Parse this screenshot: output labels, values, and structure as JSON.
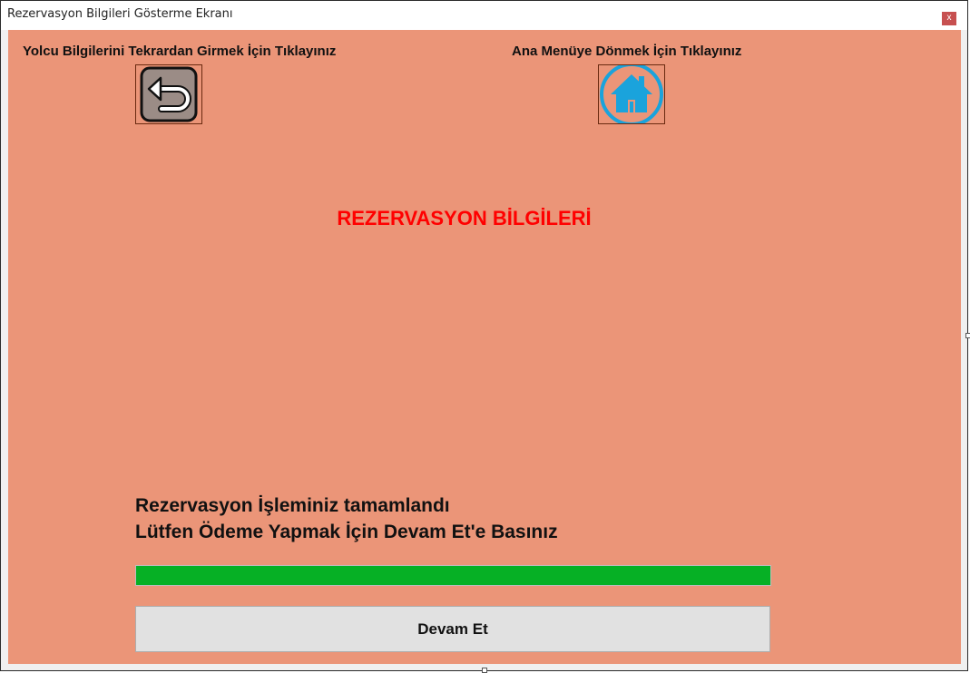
{
  "window": {
    "title": "Rezervasyon Bilgileri Gösterme Ekranı",
    "close_glyph": "x"
  },
  "top": {
    "back_label": "Yolcu Bilgilerini Tekrardan Girmek İçin Tıklayınız",
    "home_label": "Ana Menüye Dönmek İçin Tıklayınız",
    "back_icon": "undo-arrow-icon",
    "home_icon": "home-icon"
  },
  "heading": "REZERVASYON BİLGİLERİ",
  "message": {
    "line1": "Rezervasyon İşleminiz tamamlandı",
    "line2": "Lütfen Ödeme Yapmak İçin Devam Et'e Basınız"
  },
  "progress": {
    "percent": 100,
    "color": "#06b025"
  },
  "continue_button": "Devam Et",
  "colors": {
    "background": "#eb9578",
    "heading": "#ff0000",
    "home_icon": "#1aa3dc",
    "back_icon_bg": "#9b8c86"
  }
}
